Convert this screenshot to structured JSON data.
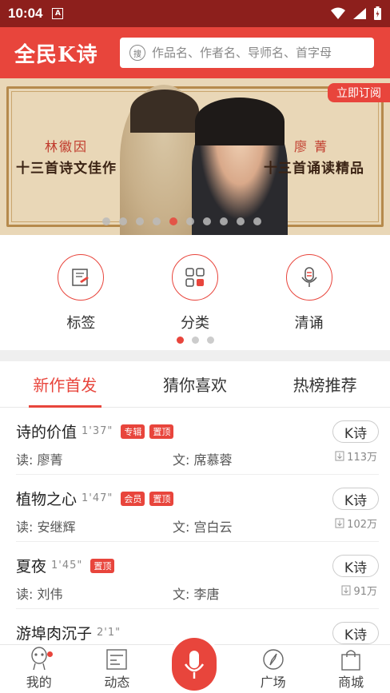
{
  "status": {
    "time": "10:04",
    "a_label": "A"
  },
  "header": {
    "logo": "全民K诗",
    "search_placeholder": "作品名、作者名、导师名、首字母",
    "search_glyph": "搜"
  },
  "banner": {
    "left_sub": "林徽因",
    "left_main": "十三首诗文佳作",
    "right_sub": "廖 菁",
    "right_main": "十三首诵读精品",
    "subscribe": "立即订阅",
    "dot_count": 10,
    "active_dot": 4
  },
  "categories": [
    {
      "label": "标签",
      "icon": "tag-icon"
    },
    {
      "label": "分类",
      "icon": "grid-icon"
    },
    {
      "label": "清诵",
      "icon": "microphone-icon"
    }
  ],
  "tabs": [
    "新作首发",
    "猜你喜欢",
    "热榜推荐"
  ],
  "active_tab": 0,
  "works": [
    {
      "title": "诗的价值",
      "duration": "1'37\"",
      "tags": [
        "专辑",
        "置顶"
      ],
      "reader": "读: 廖菁",
      "writer": "文: 席慕蓉",
      "button": "K诗",
      "downloads": "113万"
    },
    {
      "title": "植物之心",
      "duration": "1'47\"",
      "tags": [
        "会员",
        "置顶"
      ],
      "reader": "读: 安继辉",
      "writer": "文: 宫白云",
      "button": "K诗",
      "downloads": "102万"
    },
    {
      "title": "夏夜",
      "duration": "1'45\"",
      "tags": [
        "置顶"
      ],
      "reader": "读: 刘伟",
      "writer": "文: 李唐",
      "button": "K诗",
      "downloads": "91万"
    },
    {
      "title": "游埠肉沉子",
      "duration": "2'1\"",
      "tags": [],
      "reader": "",
      "writer": "",
      "button": "K诗",
      "downloads": ""
    }
  ],
  "nav": [
    {
      "label": "我的",
      "icon": "profile-icon"
    },
    {
      "label": "动态",
      "icon": "feed-icon"
    },
    {
      "label": "",
      "icon": "microphone-icon"
    },
    {
      "label": "广场",
      "icon": "compass-icon"
    },
    {
      "label": "商城",
      "icon": "shop-icon"
    }
  ],
  "colors": {
    "accent": "#e8453c",
    "status_bar": "#8d1f1c"
  }
}
